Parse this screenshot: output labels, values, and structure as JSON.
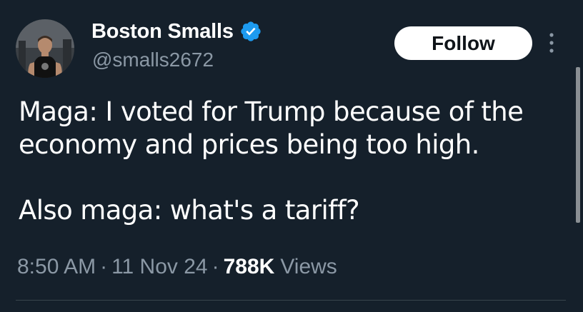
{
  "author": {
    "display_name": "Boston Smalls",
    "handle": "@smalls2672",
    "verified": true
  },
  "follow_label": "Follow",
  "tweet": {
    "line1": "Maga: I voted for Trump because of the",
    "line2": "economy and prices being too high.",
    "line3": "Also maga: what's a tariff?"
  },
  "meta": {
    "time": "8:50 AM",
    "separator": "·",
    "date": "11 Nov 24",
    "views_count": "788K",
    "views_label": "Views"
  },
  "icons": {
    "verified": "verified-badge-icon",
    "more": "more-vertical-icon"
  },
  "colors": {
    "background": "#15202b",
    "secondary_text": "#8b98a5",
    "verified_blue": "#1d9bf0"
  }
}
